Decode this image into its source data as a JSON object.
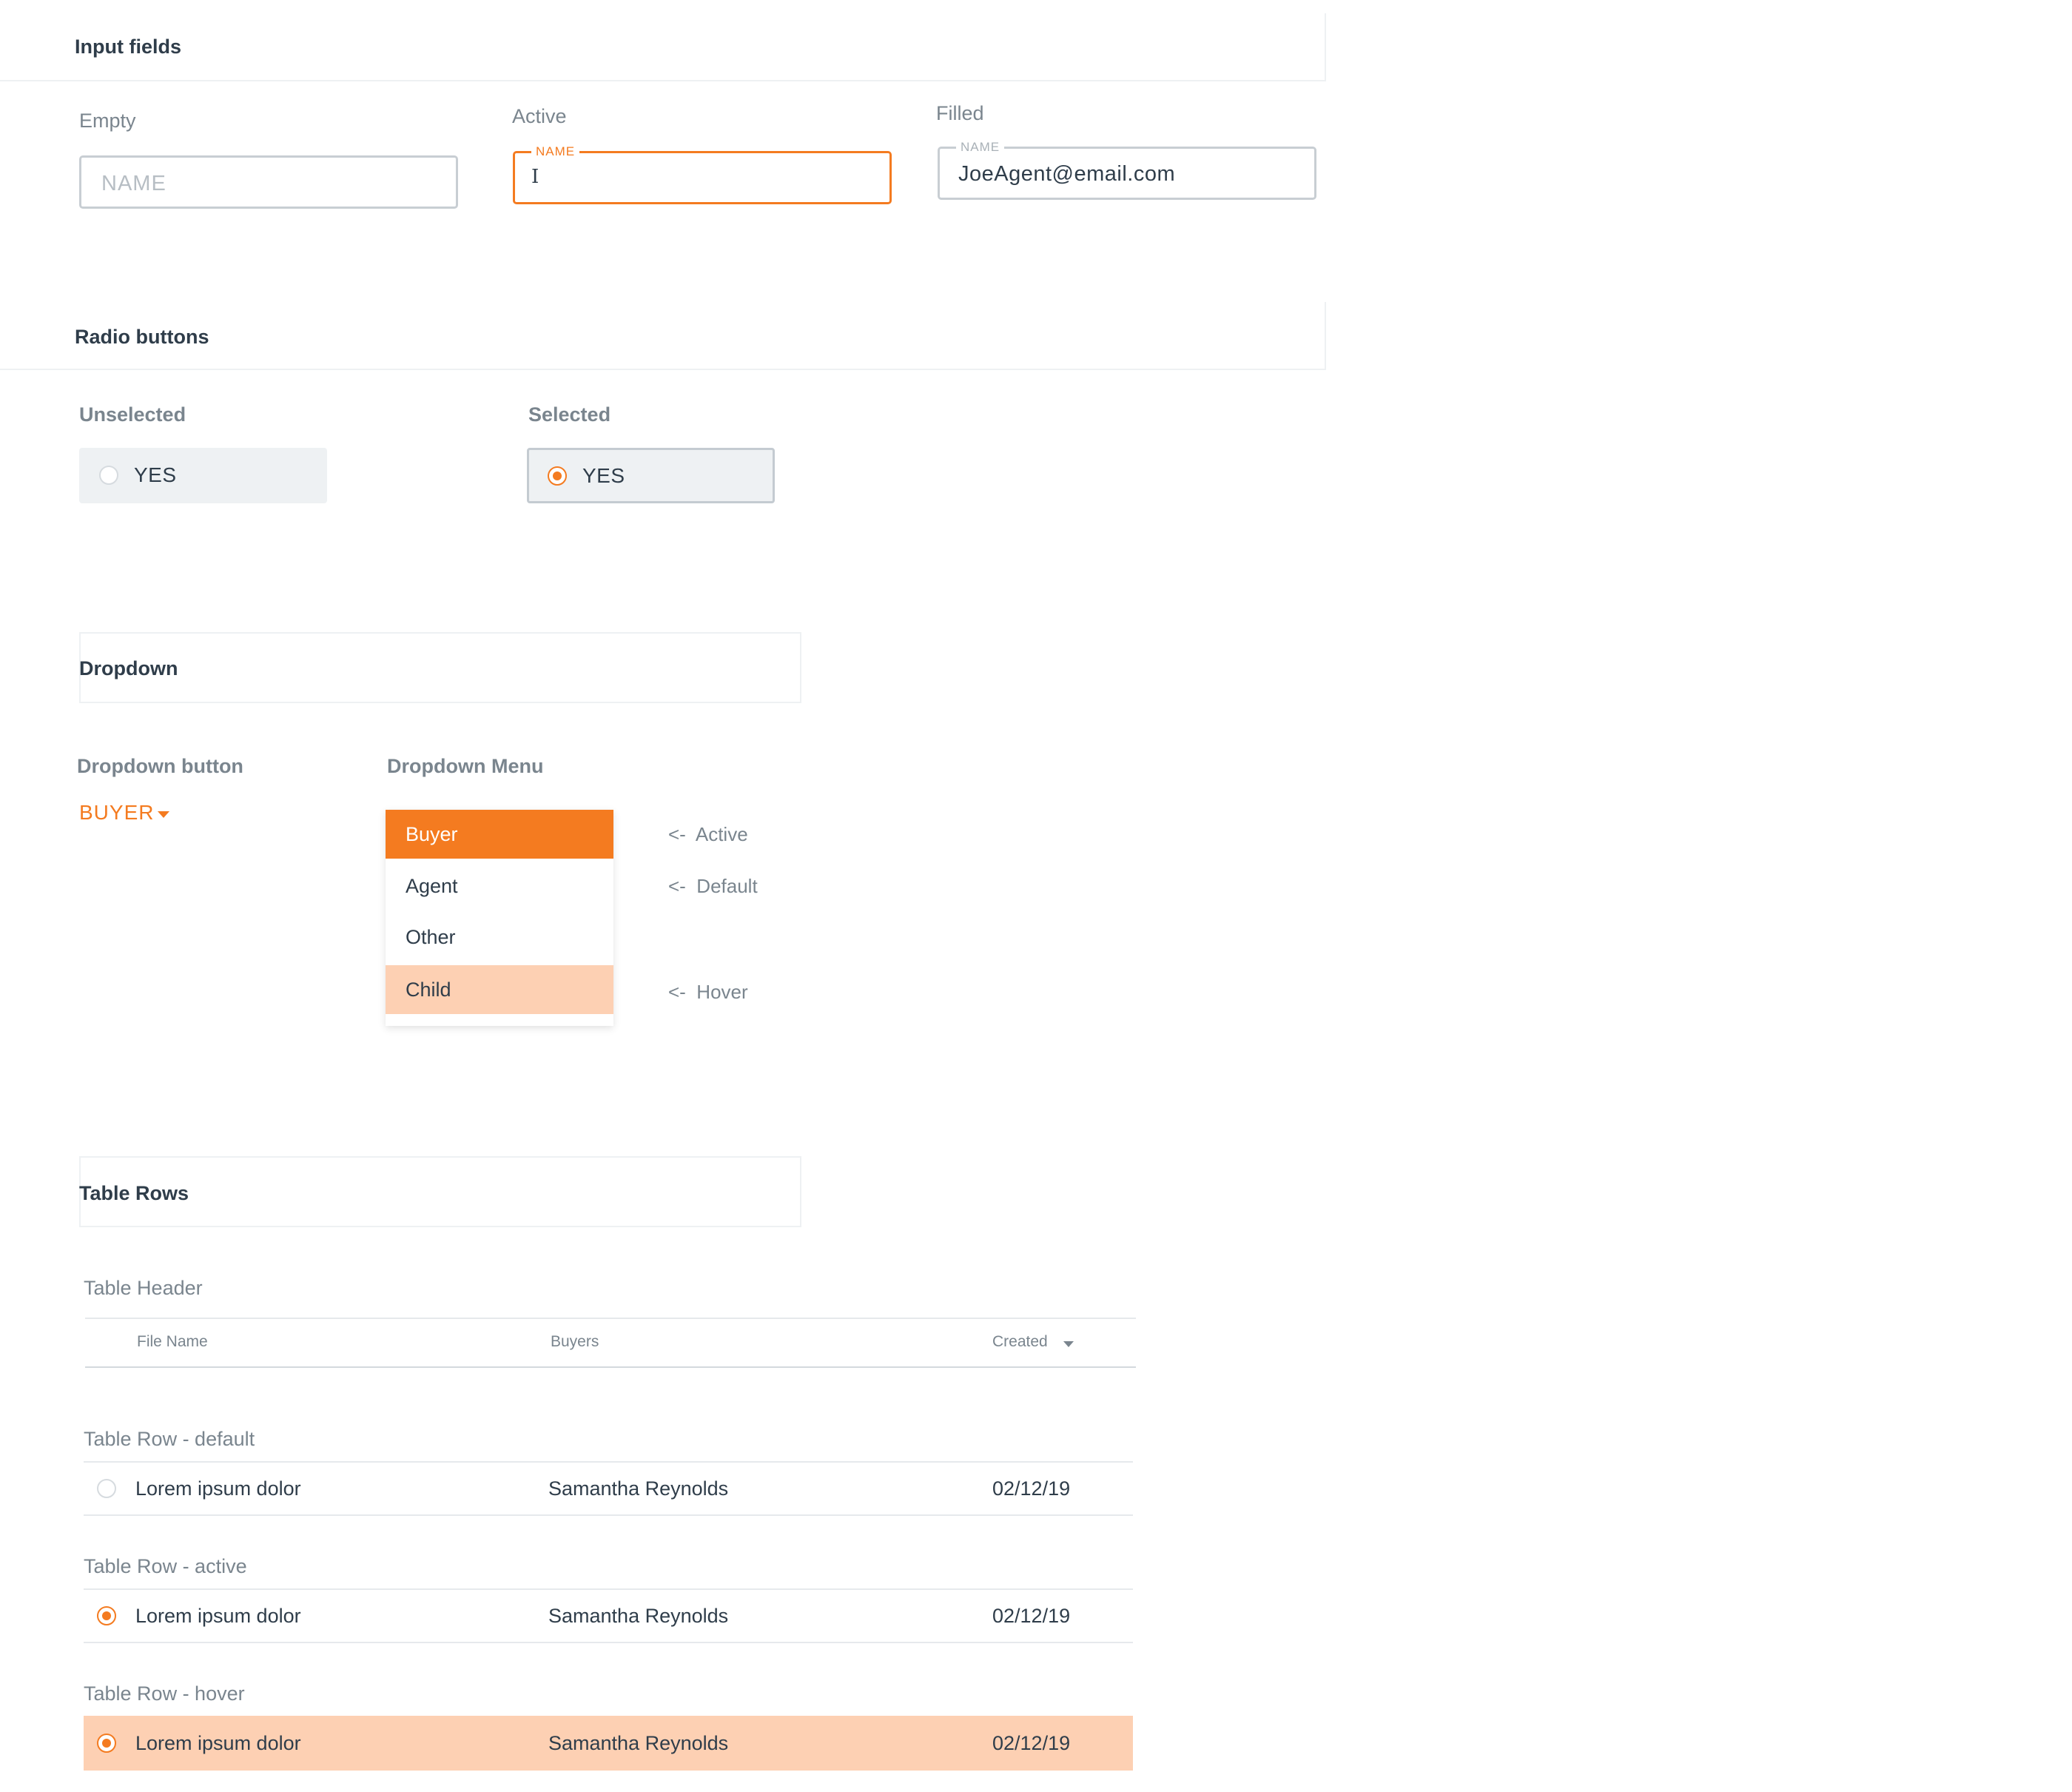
{
  "sections": {
    "input_fields": "Input fields",
    "radio_buttons": "Radio buttons",
    "dropdown": "Dropdown",
    "table_rows": "Table Rows"
  },
  "inputs": {
    "empty_label": "Empty",
    "active_label": "Active",
    "filled_label": "Filled",
    "placeholder": "NAME",
    "active_float_label": "NAME",
    "active_cursor": "I",
    "filled_float_label": "NAME",
    "filled_value": "JoeAgent@email.com"
  },
  "radios": {
    "unselected_label": "Unselected",
    "selected_label": "Selected",
    "option_text": "YES"
  },
  "dropdown": {
    "button_heading": "Dropdown button",
    "menu_heading": "Dropdown Menu",
    "button_value": "BUYER",
    "items": [
      "Buyer",
      "Agent",
      "Other",
      "Child"
    ],
    "annotations": {
      "active": "<-  Active",
      "default": "<-  Default",
      "hover": "<-  Hover"
    }
  },
  "table": {
    "header_label": "Table Header",
    "columns": [
      "File Name",
      "Buyers",
      "Created"
    ],
    "row_default_label": "Table Row - default",
    "row_active_label": "Table Row - active",
    "row_hover_label": "Table Row - hover",
    "row": {
      "file_name": "Lorem ipsum dolor",
      "buyer": "Samantha Reynolds",
      "created": "02/12/19"
    }
  },
  "colors": {
    "accent": "#f47b20",
    "hover": "#fdd0b3",
    "text": "#2f3d4a",
    "muted": "#7a858e"
  }
}
